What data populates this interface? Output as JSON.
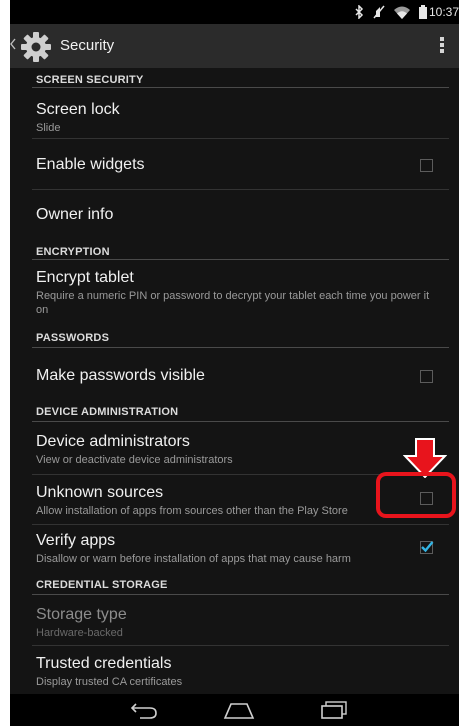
{
  "status_bar": {
    "time": "10:37",
    "icons": [
      "bluetooth-icon",
      "no-sound-icon",
      "wifi-icon",
      "battery-icon"
    ]
  },
  "action_bar": {
    "title": "Security",
    "icon": "gear-icon"
  },
  "sections": [
    {
      "header": "SCREEN SECURITY"
    },
    {
      "header": "ENCRYPTION"
    },
    {
      "header": "PASSWORDS"
    },
    {
      "header": "DEVICE ADMINISTRATION"
    },
    {
      "header": "CREDENTIAL STORAGE"
    }
  ],
  "items": {
    "screen_lock": {
      "title": "Screen lock",
      "summary": "Slide"
    },
    "enable_widgets": {
      "title": "Enable widgets",
      "checked": false
    },
    "owner_info": {
      "title": "Owner info"
    },
    "encrypt_tablet": {
      "title": "Encrypt tablet",
      "summary": "Require a numeric PIN or password to decrypt your tablet each time you power it on"
    },
    "make_passwords_visible": {
      "title": "Make passwords visible",
      "checked": false
    },
    "device_administrators": {
      "title": "Device administrators",
      "summary": "View or deactivate device administrators"
    },
    "unknown_sources": {
      "title": "Unknown sources",
      "summary": "Allow installation of apps from sources other than the Play Store",
      "checked": false
    },
    "verify_apps": {
      "title": "Verify apps",
      "summary": "Disallow or warn before installation of apps that may cause harm",
      "checked": true
    },
    "storage_type": {
      "title": "Storage type",
      "summary": "Hardware-backed",
      "disabled": true
    },
    "trusted_credentials": {
      "title": "Trusted credentials",
      "summary": "Display trusted CA certificates"
    }
  },
  "colors": {
    "background": "#141414",
    "action_bar": "#2b2b2b",
    "accent_check": "#33b5e5",
    "annotation": "#e8141c"
  },
  "nav_bar": {
    "icons": [
      "back-icon",
      "home-icon",
      "recents-icon"
    ]
  }
}
